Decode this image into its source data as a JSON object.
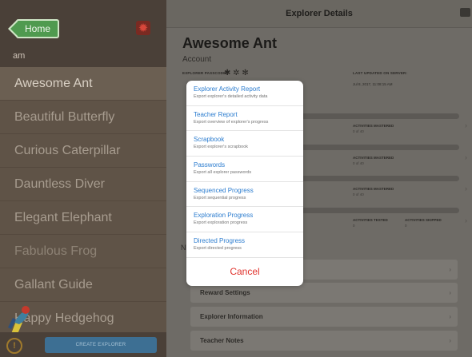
{
  "sidebar": {
    "home_label": "Home",
    "search_text": "am",
    "explorers": [
      "Awesome Ant",
      "Beautiful Butterfly",
      "Curious Caterpillar",
      "Dauntless Diver",
      "Elegant Elephant",
      "Fabulous Frog",
      "Gallant Guide",
      "Happy Hedgehog"
    ],
    "selected_index": 0,
    "create_label": "CREATE EXPLORER",
    "info_glyph": "!"
  },
  "main": {
    "header_title": "Explorer Details",
    "explorer_name": "Awesome Ant",
    "account_label": "Account",
    "passcode_label": "EXPLORER PASSCODE",
    "updated_label": "LAST UPDATED ON SERVER:",
    "updated_value": "Jul 8, 2017, 11:08:15 AM",
    "stats": [
      {
        "label": "ACTIVITIES MASTERED",
        "value": "0 of 40"
      },
      {
        "label": "ACTIVITIES MASTERED",
        "value": "0 of 40"
      },
      {
        "label": "ACTIVITIES MASTERED",
        "value": "0 of 40"
      }
    ],
    "tested_label": "ACTIVITIES TESTED",
    "tested_value": "0",
    "skipped_label": "ACTIVITIES SKIPPED",
    "skipped_value": "0",
    "section_n": "N",
    "settings_rows": [
      "Reward Settings",
      "Explorer Information",
      "Teacher Notes"
    ]
  },
  "popover": {
    "items": [
      {
        "title": "Explorer Activity Report",
        "subtitle": "Export explorer's detailed activity data"
      },
      {
        "title": "Teacher Report",
        "subtitle": "Export overview of explorer's progress"
      },
      {
        "title": "Scrapbook",
        "subtitle": "Export explorer's scrapbook"
      },
      {
        "title": "Passwords",
        "subtitle": "Export all explorer passwords"
      },
      {
        "title": "Sequenced Progress",
        "subtitle": "Export sequential progress"
      },
      {
        "title": "Exploration Progress",
        "subtitle": "Export exploration progress"
      },
      {
        "title": "Directed Progress",
        "subtitle": "Export directed progress"
      }
    ],
    "cancel_label": "Cancel"
  },
  "colors": {
    "menu_title": "#2b7ccf",
    "cancel": "#e0332d",
    "home_button": "#4f9a4f"
  },
  "icons": {
    "home": "back-arrow-icon",
    "settings": "gear-icon",
    "info": "info-icon",
    "header_action": "export-icon"
  }
}
